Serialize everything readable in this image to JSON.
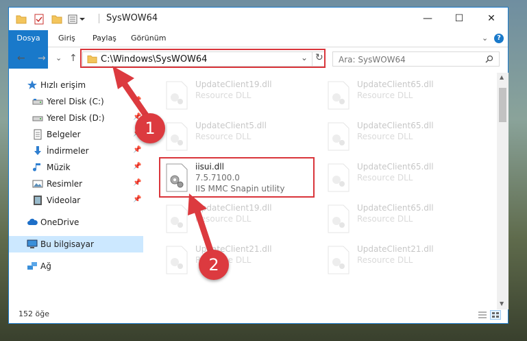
{
  "window": {
    "title": "SysWOW64",
    "controls": [
      "—",
      "☐",
      "✕"
    ]
  },
  "ribbon": {
    "tabs": [
      "Dosya",
      "Giriş",
      "Paylaş",
      "Görünüm"
    ],
    "expand": "⌄",
    "help": "?"
  },
  "address": {
    "path": "C:\\Windows\\SysWOW64",
    "dropdown": "⌄",
    "refresh": "↻"
  },
  "search": {
    "placeholder": "Ara: SysWOW64"
  },
  "nav": {
    "back": "←",
    "forward": "→",
    "recent": "⌄",
    "up": "↑"
  },
  "navpane": {
    "items": [
      {
        "label": "Hızlı erişim",
        "icon": "star-icon"
      },
      {
        "label": "Yerel Disk (C:)",
        "icon": "drive-icon"
      },
      {
        "label": "Yerel Disk (D:)",
        "icon": "drive-icon"
      },
      {
        "label": "Belgeler",
        "icon": "documents-icon"
      },
      {
        "label": "İndirmeler",
        "icon": "download-icon"
      },
      {
        "label": "Müzik",
        "icon": "music-icon"
      },
      {
        "label": "Resimler",
        "icon": "pictures-icon"
      },
      {
        "label": "Videolar",
        "icon": "video-icon"
      },
      {
        "label": "OneDrive",
        "icon": "cloud-icon"
      },
      {
        "label": "Bu bilgisayar",
        "icon": "computer-icon"
      },
      {
        "label": "Ağ",
        "icon": "network-icon"
      }
    ]
  },
  "files": {
    "left": [
      {
        "name": "UpdateClient19.dll",
        "type": "Resource DLL"
      },
      {
        "name": "UpdateClient5.dll",
        "type": "Resource DLL"
      },
      {
        "name": "iisui.dll",
        "version": "7.5.7100.0",
        "desc": "IIS MMC Snapin utility"
      },
      {
        "name": "UpdateClient19.dll",
        "type": "Resource DLL"
      },
      {
        "name": "UpdateClient21.dll",
        "type": "Resource DLL"
      }
    ],
    "right": [
      {
        "name": "UpdateClient65.dll",
        "type": "Resource DLL"
      },
      {
        "name": "UpdateClient65.dll",
        "type": "Resource DLL"
      },
      {
        "name": "UpdateClient65.dll",
        "type": "Resource DLL"
      },
      {
        "name": "UpdateClient65.dll",
        "type": "Resource DLL"
      },
      {
        "name": "UpdateClient21.dll",
        "type": "Resource DLL"
      }
    ]
  },
  "status": {
    "count": "152 öğe"
  },
  "annotations": {
    "step1": "1",
    "step2": "2"
  },
  "colors": {
    "accent": "#1979ca",
    "highlight": "#d9343a",
    "badge": "#dc3a3f",
    "selected": "#cce8ff"
  }
}
